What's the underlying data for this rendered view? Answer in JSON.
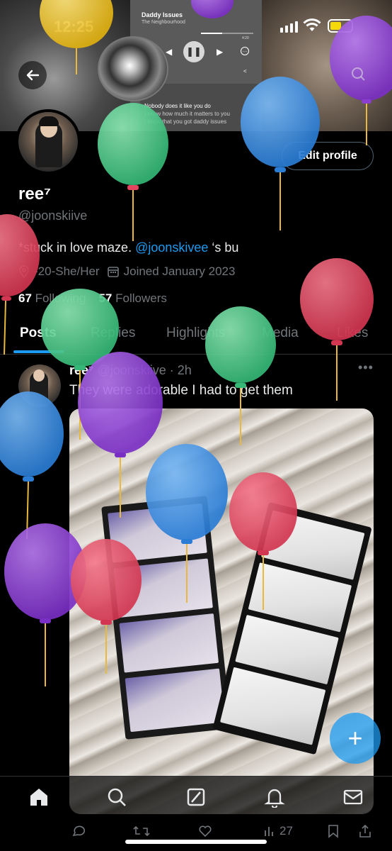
{
  "status_bar": {
    "time": "12:25"
  },
  "banner": {
    "song_title": "Daddy Issues",
    "artist": "The Neighbourhood",
    "time_remaining": "4:20",
    "lyrics": [
      "Nobody does it like you do",
      "I know how much it matters to you",
      "I know that you got daddy issues"
    ]
  },
  "profile": {
    "edit_button": "Edit profile",
    "display_name": "ree⁷",
    "handle": "@joonskiive",
    "bio_prefix": "*stuck in love maze. ",
    "bio_mention": "@joonskivee",
    "bio_suffix": " ‘s bu",
    "meta_info": "-20-She/Her",
    "joined": "Joined January 2023",
    "following_count": "67",
    "following_label": "Following",
    "followers_count": "57",
    "followers_label": "Followers"
  },
  "tabs": [
    "Posts",
    "Replies",
    "Highlights",
    "Media",
    "Likes"
  ],
  "tweet": {
    "name": "ree⁷",
    "handle": "@joonskiive",
    "time": "2h",
    "text": "They were adorable I had to get them",
    "views": "27"
  },
  "fab_label": "+",
  "colors": {
    "accent": "#1d9bf0",
    "balloon_red": "#e2455d",
    "balloon_blue": "#3b8fe0",
    "balloon_green": "#4ec98a",
    "balloon_purple": "#8e3fd6",
    "balloon_yellow": "#f0c419"
  },
  "icons": {
    "nav": [
      "home-icon",
      "search-icon",
      "grok-icon",
      "notifications-icon",
      "messages-icon"
    ],
    "actions": [
      "reply-icon",
      "retweet-icon",
      "like-icon",
      "views-icon",
      "bookmark-icon",
      "share-icon"
    ]
  }
}
